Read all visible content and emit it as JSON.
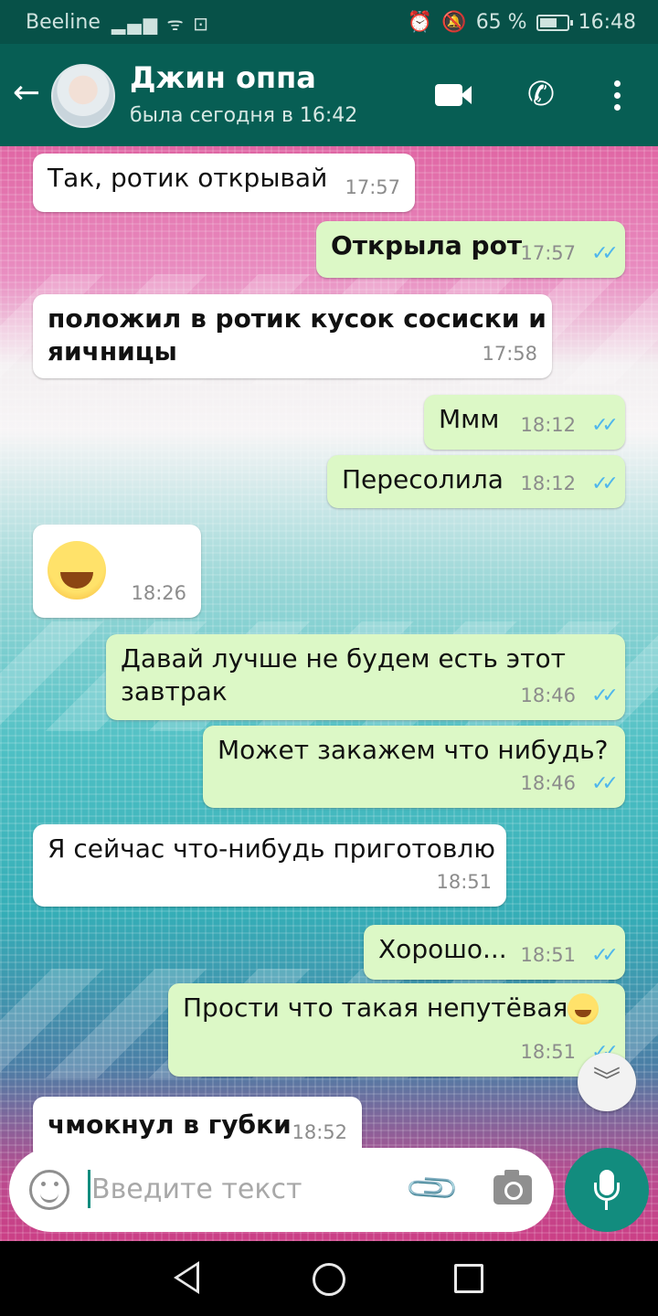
{
  "status_bar": {
    "carrier": "Beeline",
    "battery_percent": "65 %",
    "battery_level": 0.65,
    "time": "16:48"
  },
  "header": {
    "contact_name": "Джин оппа",
    "last_seen": "была сегодня в 16:42"
  },
  "messages": [
    {
      "direction": "in",
      "text": "Так, ротик открывай",
      "time": "17:57"
    },
    {
      "direction": "out",
      "text": "Открыла рот",
      "time": "17:57"
    },
    {
      "direction": "in",
      "text": "положил в ротик кусок сосиски и",
      "text2": "яичницы",
      "time": "17:58"
    },
    {
      "direction": "out",
      "text": "Ммм",
      "time": "18:12"
    },
    {
      "direction": "out",
      "text": "Пересолила",
      "time": "18:12"
    },
    {
      "direction": "in",
      "emoji": "tears-of-joy-emoji",
      "time": "18:26"
    },
    {
      "direction": "out",
      "text": "Давай лучше не будем есть этот",
      "text2": "завтрак",
      "time": "18:46"
    },
    {
      "direction": "out",
      "text": "Может закажем что нибудь?",
      "time": "18:46"
    },
    {
      "direction": "in",
      "text": "Я сейчас что-нибудь приготовлю",
      "time": "18:51"
    },
    {
      "direction": "out",
      "text": "Хорошо...",
      "time": "18:51"
    },
    {
      "direction": "out",
      "text": "Прости что такая непутёвая",
      "emoji": "sweat-smile-emoji",
      "time": "18:51"
    },
    {
      "direction": "in",
      "text": "чмокнул в губки",
      "time": "18:52"
    }
  ],
  "composer": {
    "placeholder": "Введите текст"
  },
  "colors": {
    "header": "#075e54",
    "status_bar": "#075148",
    "outgoing_bubble": "#dcf8c6",
    "incoming_bubble": "#ffffff",
    "read_ticks": "#4fb6ec",
    "accent": "#128c7e"
  },
  "icons": {
    "back": "arrow-left-icon",
    "video_call": "video-camera-icon",
    "voice_call": "phone-icon",
    "menu": "more-vert-icon",
    "emoji": "smiley-icon",
    "attach": "paperclip-icon",
    "camera": "camera-icon",
    "mic": "microphone-icon",
    "scroll": "chevron-double-down-icon"
  }
}
